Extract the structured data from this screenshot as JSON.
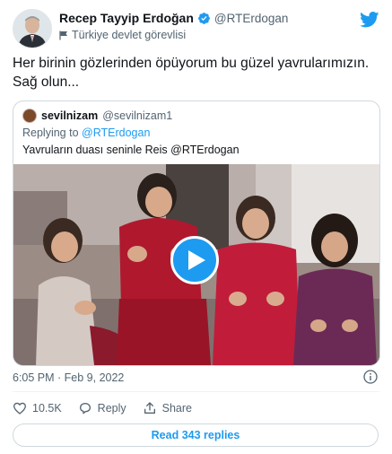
{
  "author": {
    "name": "Recep Tayyip Erdoğan",
    "handle": "@RTErdogan",
    "label": "Türkiye devlet görevlisi"
  },
  "tweet": {
    "text": "Her birinin gözlerinden öpüyorum bu güzel yavrularımızın.\nSağ olun...",
    "timestamp": "6:05 PM · Feb 9, 2022"
  },
  "quote": {
    "name": "sevilnizam",
    "handle": "@sevilnizam1",
    "replying_prefix": "Replying to",
    "replying_to": "@RTErdogan",
    "text": "Yavruların duası seninle Reis @RTErdogan"
  },
  "actions": {
    "likes": "10.5K",
    "reply_label": "Reply",
    "share_label": "Share"
  },
  "read_replies_label": "Read 343 replies",
  "colors": {
    "accent": "#1d9bf0",
    "text": "#0f1419",
    "muted": "#536471",
    "border": "#cfd9de"
  }
}
